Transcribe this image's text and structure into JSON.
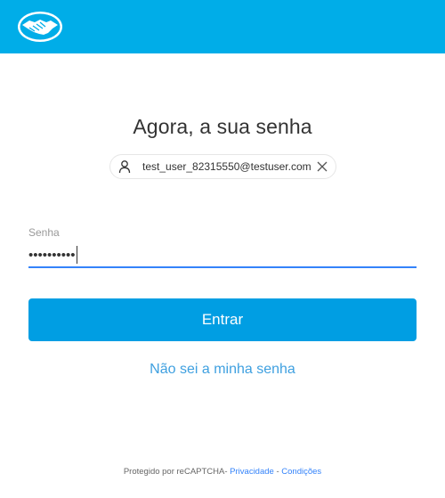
{
  "header": {
    "logo_icon": "handshake-logo-icon",
    "background_color": "#00ade8"
  },
  "title": "Agora, a sua senha",
  "account_chip": {
    "avatar_icon": "user-icon",
    "email": "test_user_82315550@testuser.com",
    "close_icon": "close-icon"
  },
  "password": {
    "label": "Senha",
    "masked_value": "••••••••••"
  },
  "submit_label": "Entrar",
  "forgot_label": "Não sei a minha senha",
  "footer": {
    "text": "Protegido por reCAPTCHA- ",
    "privacy_label": "Privacidade",
    "separator": " - ",
    "terms_label": "Condições"
  },
  "colors": {
    "accent": "#009ee3",
    "input_focus": "#3483fa",
    "link": "#3fa0e0"
  }
}
